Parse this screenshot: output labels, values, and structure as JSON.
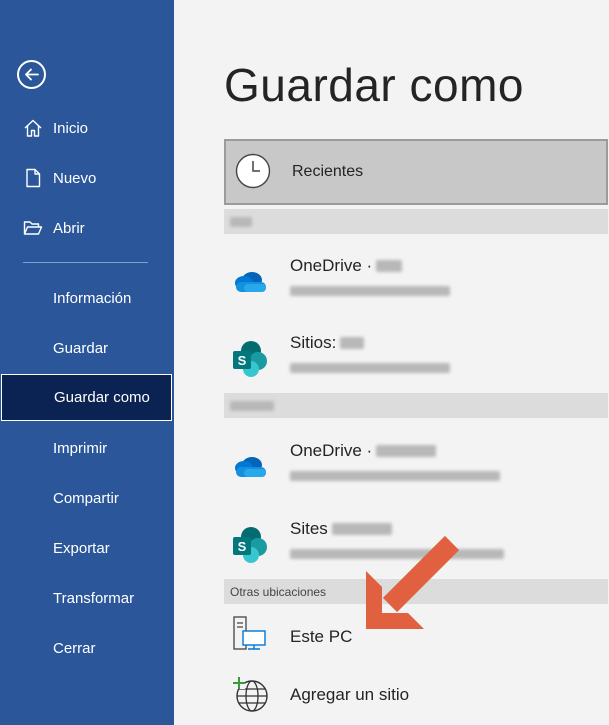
{
  "sidebar": {
    "back_icon": "back-arrow-icon",
    "nav_top": [
      {
        "label": "Inicio",
        "icon": "home-icon"
      },
      {
        "label": "Nuevo",
        "icon": "new-document-icon"
      },
      {
        "label": "Abrir",
        "icon": "folder-open-icon"
      }
    ],
    "nav_bottom": [
      {
        "label": "Información"
      },
      {
        "label": "Guardar"
      },
      {
        "label": "Guardar como",
        "selected": true
      },
      {
        "label": "Imprimir"
      },
      {
        "label": "Compartir"
      },
      {
        "label": "Exportar"
      },
      {
        "label": "Transformar"
      },
      {
        "label": "Cerrar"
      }
    ],
    "color": "#2b579a",
    "selected_color": "#0b2352"
  },
  "main": {
    "title": "Guardar como",
    "recent": {
      "label": "Recientes",
      "icon": "clock-icon"
    },
    "group1": {
      "header": "",
      "items": [
        {
          "name": "OneDrive ·",
          "icon": "onedrive-icon"
        },
        {
          "name": "Sitios:",
          "icon": "sharepoint-icon"
        }
      ]
    },
    "group2": {
      "header": "",
      "items": [
        {
          "name": "OneDrive ·",
          "icon": "onedrive-icon"
        },
        {
          "name": "Sites",
          "icon": "sharepoint-icon"
        }
      ]
    },
    "other": {
      "header": "Otras ubicaciones",
      "items": [
        {
          "name": "Este PC",
          "icon": "pc-icon"
        },
        {
          "name": "Agregar un sitio",
          "icon": "add-place-icon"
        }
      ]
    },
    "annotation_arrow_color": "#e06040"
  }
}
